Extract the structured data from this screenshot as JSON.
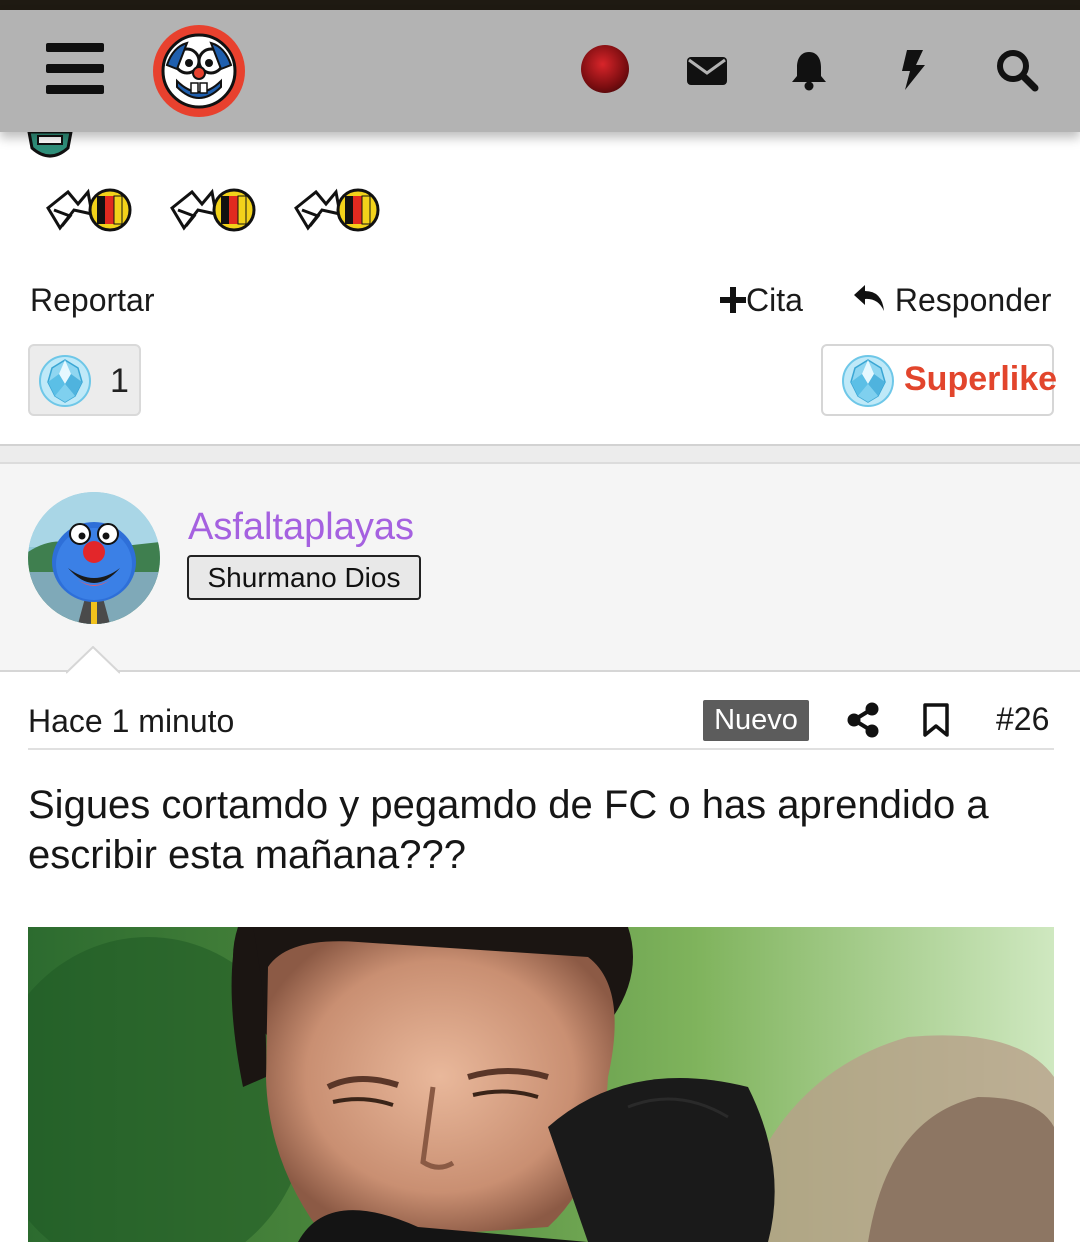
{
  "header": {
    "menu_icon": "hamburger-menu-icon",
    "logo": "forocoches-logo",
    "icons": [
      "user-avatar",
      "envelope-icon",
      "bell-icon",
      "bolt-icon",
      "search-icon"
    ]
  },
  "previous_post": {
    "report_label": "Reportar",
    "quote_label": "Cita",
    "reply_label": "Responder",
    "like_count": "1",
    "superlike_label": "Superlike"
  },
  "post": {
    "author": {
      "username": "Asfaltaplayas",
      "rank": "Shurmano Dios"
    },
    "time": "Hace 1 minuto",
    "new_badge": "Nuevo",
    "number": "#26",
    "text": "Sigues cortamdo y pegamdo de FC o has aprendido a escribir esta mañana???"
  },
  "colors": {
    "header_bg": "#b3b3b3",
    "logo_bg": "#e8412e",
    "username": "#a561e0",
    "superlike": "#e2452c",
    "badge_bg": "#5c5c5c"
  }
}
